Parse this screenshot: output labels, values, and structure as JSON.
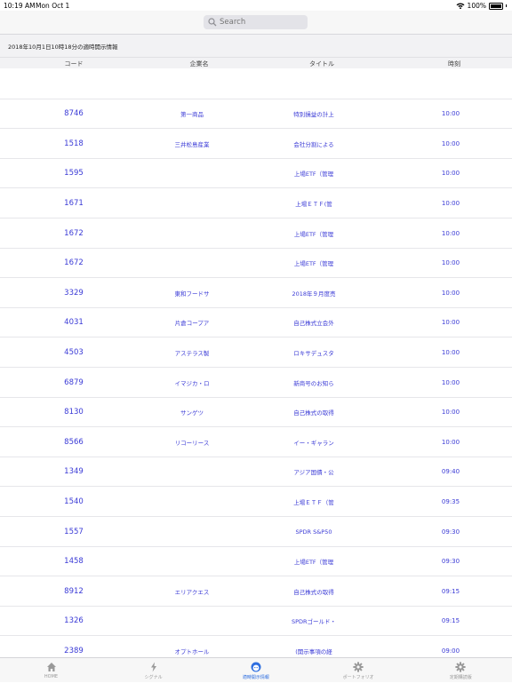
{
  "status_bar": {
    "time": "10:19 AM",
    "date": "Mon Oct 1",
    "battery": "100%"
  },
  "search": {
    "placeholder": "Search"
  },
  "section_title": "2018年10月1日10時18分の適時開示情報",
  "columns": {
    "code": "コード",
    "company": "企業名",
    "title": "タイトル",
    "time": "時刻"
  },
  "rows": [
    {
      "code": "",
      "company": "",
      "title": "",
      "time": ""
    },
    {
      "code": "8746",
      "company": "第一商品",
      "title": "特別損益の計上",
      "time": "10:00"
    },
    {
      "code": "1518",
      "company": "三井松島産業",
      "title": "会社分割による",
      "time": "10:00"
    },
    {
      "code": "1595",
      "company": "",
      "title": "上場ETF（管理",
      "time": "10:00"
    },
    {
      "code": "1671",
      "company": "",
      "title": "上場ＥＴＦ(管",
      "time": "10:00"
    },
    {
      "code": "1672",
      "company": "",
      "title": "上場ETF（管理",
      "time": "10:00"
    },
    {
      "code": "1672",
      "company": "",
      "title": "上場ETF（管理",
      "time": "10:00"
    },
    {
      "code": "3329",
      "company": "東和フードサ",
      "title": "2018年９月度売",
      "time": "10:00"
    },
    {
      "code": "4031",
      "company": "片倉コープア",
      "title": "自己株式立会外",
      "time": "10:00"
    },
    {
      "code": "4503",
      "company": "アステラス製",
      "title": "ロキサデュスタ",
      "time": "10:00"
    },
    {
      "code": "6879",
      "company": "イマジカ・ロ",
      "title": "新商号のお知ら",
      "time": "10:00"
    },
    {
      "code": "8130",
      "company": "サンゲツ",
      "title": "自己株式の取得",
      "time": "10:00"
    },
    {
      "code": "8566",
      "company": "リコーリース",
      "title": "イー・ギャラン",
      "time": "10:00"
    },
    {
      "code": "1349",
      "company": "",
      "title": "アジア国債・公",
      "time": "09:40"
    },
    {
      "code": "1540",
      "company": "",
      "title": "上場ＥＴＦ（管",
      "time": "09:35"
    },
    {
      "code": "1557",
      "company": "",
      "title": "SPDR S&P50",
      "time": "09:30"
    },
    {
      "code": "1458",
      "company": "",
      "title": "上場ETF（管理",
      "time": "09:30"
    },
    {
      "code": "8912",
      "company": "エリアクエス",
      "title": "自己株式の取得",
      "time": "09:15"
    },
    {
      "code": "1326",
      "company": "",
      "title": "SPDRゴールド・",
      "time": "09:15"
    },
    {
      "code": "2389",
      "company": "オプトホール",
      "title": "(開示事項の経",
      "time": "09:00"
    }
  ],
  "tabs": [
    {
      "label": "HOME",
      "icon": "home-icon",
      "active": false
    },
    {
      "label": "シグナル",
      "icon": "lightning-icon",
      "active": false
    },
    {
      "label": "適時開示情報",
      "icon": "face-icon",
      "active": true
    },
    {
      "label": "ポートフォリオ",
      "icon": "gear-icon",
      "active": false
    },
    {
      "label": "定期購読版",
      "icon": "gear-icon",
      "active": false
    }
  ],
  "colors": {
    "accent": "#3a3ad6",
    "tab_active": "#2f6fe0",
    "tab_inactive": "#999999"
  }
}
